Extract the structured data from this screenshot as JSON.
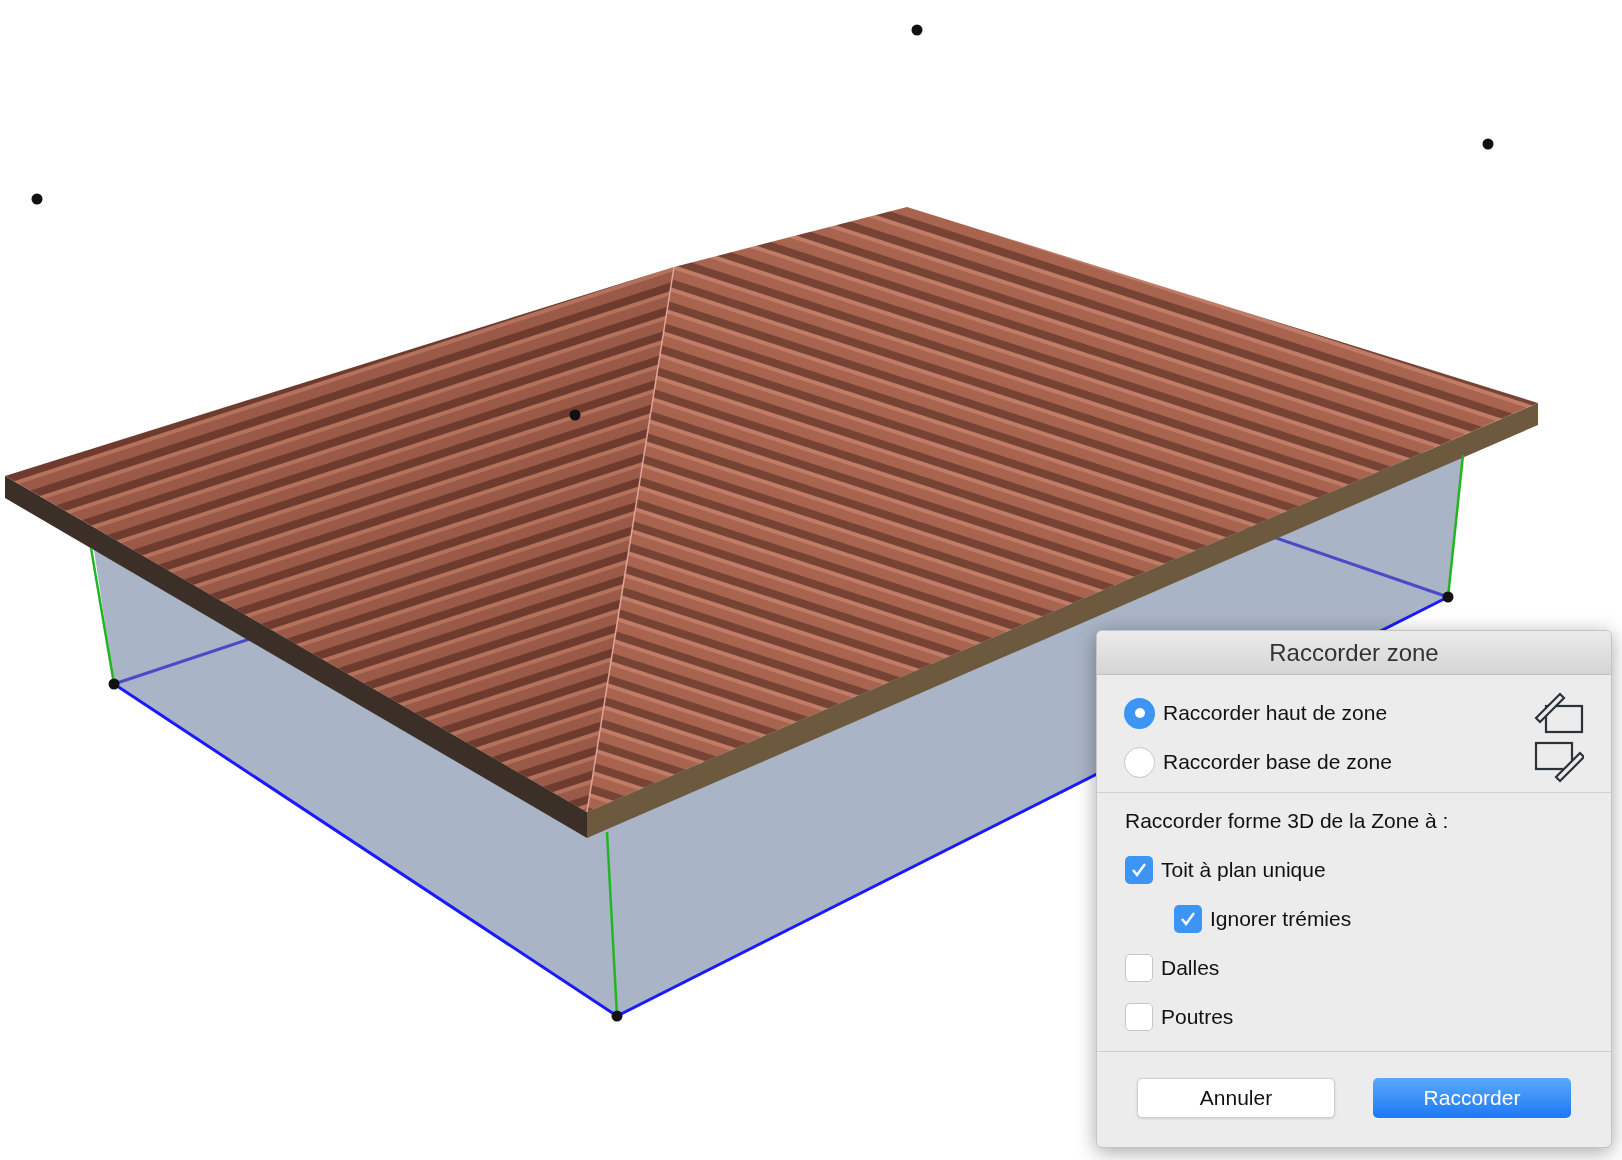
{
  "dialog": {
    "title": "Raccorder zone",
    "options": [
      {
        "label": "Raccorder haut de zone",
        "selected": true
      },
      {
        "label": "Raccorder base de zone",
        "selected": false
      }
    ],
    "section_label": "Raccorder forme 3D de la Zone à :",
    "checkboxes": [
      {
        "label": "Toit à plan unique",
        "checked": true,
        "children": [
          {
            "label": "Ignorer trémies",
            "checked": true
          }
        ]
      },
      {
        "label": "Dalles",
        "checked": false
      },
      {
        "label": "Poutres",
        "checked": false
      }
    ],
    "buttons": [
      {
        "label": "Annuler",
        "kind": "secondary"
      },
      {
        "label": "Raccorder",
        "kind": "primary"
      }
    ]
  }
}
